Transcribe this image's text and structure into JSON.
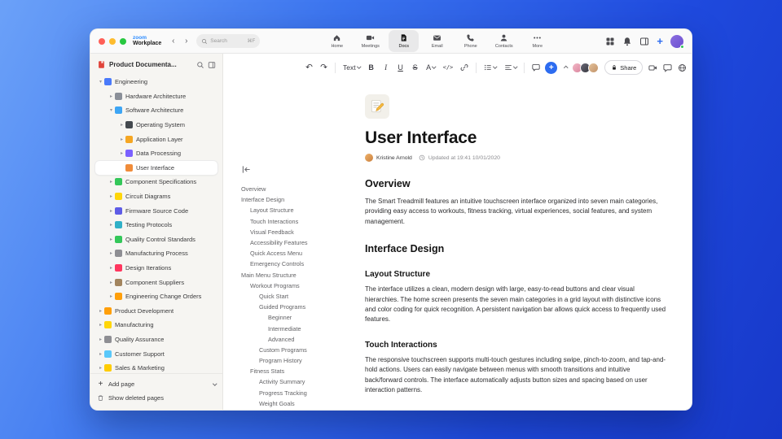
{
  "titlebar": {
    "logo": {
      "top": "zoom",
      "bottom": "Workplace"
    },
    "search": {
      "placeholder": "Search",
      "shortcut": "⌘F"
    },
    "tabs": [
      {
        "label": "Home",
        "icon": "home",
        "active": false
      },
      {
        "label": "Meetings",
        "icon": "meetings",
        "active": false
      },
      {
        "label": "Docs",
        "icon": "docs",
        "active": true
      },
      {
        "label": "Email",
        "icon": "email",
        "active": false
      },
      {
        "label": "Phone",
        "icon": "phone",
        "active": false
      },
      {
        "label": "Contacts",
        "icon": "contacts",
        "active": false
      },
      {
        "label": "More",
        "icon": "more",
        "active": false
      }
    ]
  },
  "sidebar": {
    "title": "Product Documenta...",
    "tree": [
      {
        "label": "Engineering",
        "level": 0,
        "chevron": "down",
        "color": "#4a7afa",
        "icon": "engineering"
      },
      {
        "label": "Hardware Architecture",
        "level": 1,
        "chevron": "right",
        "color": "#8a8f98",
        "icon": "hardware-architecture"
      },
      {
        "label": "Software Architecture",
        "level": 1,
        "chevron": "down",
        "color": "#3da5f4",
        "icon": "software-architecture"
      },
      {
        "label": "Operating System",
        "level": 2,
        "chevron": "right",
        "color": "#44494f",
        "icon": "operating-system"
      },
      {
        "label": "Application Layer",
        "level": 2,
        "chevron": "right",
        "color": "#f5a623",
        "icon": "application-layer"
      },
      {
        "label": "Data Processing",
        "level": 2,
        "chevron": "right",
        "color": "#7b61ff",
        "icon": "data-processing"
      },
      {
        "label": "User Interface",
        "level": 2,
        "chevron": "none",
        "color": "#f08c3a",
        "icon": "user-interface",
        "selected": true
      },
      {
        "label": "Component Specifications",
        "level": 1,
        "chevron": "right",
        "color": "#34c759",
        "icon": "component-specifications"
      },
      {
        "label": "Circuit Diagrams",
        "level": 1,
        "chevron": "right",
        "color": "#ffd60a",
        "icon": "circuit-diagrams"
      },
      {
        "label": "Firmware Source Code",
        "level": 1,
        "chevron": "right",
        "color": "#5e5ce6",
        "icon": "firmware-source-code"
      },
      {
        "label": "Testing Protocols",
        "level": 1,
        "chevron": "right",
        "color": "#30b0c7",
        "icon": "testing-protocols"
      },
      {
        "label": "Quality Control Standards",
        "level": 1,
        "chevron": "right",
        "color": "#34c759",
        "icon": "quality-control-standards"
      },
      {
        "label": "Manufacturing Process",
        "level": 1,
        "chevron": "right",
        "color": "#8e8e93",
        "icon": "manufacturing-process"
      },
      {
        "label": "Design Iterations",
        "level": 1,
        "chevron": "right",
        "color": "#ff375f",
        "icon": "design-iterations"
      },
      {
        "label": "Component Suppliers",
        "level": 1,
        "chevron": "right",
        "color": "#a2845e",
        "icon": "component-suppliers"
      },
      {
        "label": "Engineering Change Orders",
        "level": 1,
        "chevron": "right",
        "color": "#ff9f0a",
        "icon": "engineering-change-orders"
      },
      {
        "label": "Product Development",
        "level": 0,
        "chevron": "right",
        "color": "#ff9f0a",
        "icon": "product-development"
      },
      {
        "label": "Manufacturing",
        "level": 0,
        "chevron": "right",
        "color": "#ffd60a",
        "icon": "manufacturing"
      },
      {
        "label": "Quality Assurance",
        "level": 0,
        "chevron": "right",
        "color": "#8e8e93",
        "icon": "quality-assurance"
      },
      {
        "label": "Customer Support",
        "level": 0,
        "chevron": "right",
        "color": "#5ac8fa",
        "icon": "customer-support"
      },
      {
        "label": "Sales & Marketing",
        "level": 0,
        "chevron": "right",
        "color": "#ffcc00",
        "icon": "sales-marketing"
      }
    ],
    "add_page": "Add page",
    "show_deleted": "Show deleted pages"
  },
  "toolbar": {
    "buttons": [
      {
        "name": "undo",
        "glyph": "↶"
      },
      {
        "name": "redo",
        "glyph": "↷"
      },
      {
        "name": "divider"
      },
      {
        "name": "text-style",
        "glyph": "Text",
        "dropdown": true
      },
      {
        "name": "bold",
        "glyph": "B"
      },
      {
        "name": "italic",
        "glyph": "I"
      },
      {
        "name": "underline",
        "glyph": "U"
      },
      {
        "name": "strikethrough",
        "glyph": "S"
      },
      {
        "name": "text-color",
        "glyph": "A",
        "dropdown": true
      },
      {
        "name": "inline-code",
        "glyph": "</>"
      },
      {
        "name": "link",
        "icon": "link"
      },
      {
        "name": "divider"
      },
      {
        "name": "bullet-list",
        "icon": "list",
        "dropdown": true
      },
      {
        "name": "align",
        "icon": "align",
        "dropdown": true
      },
      {
        "name": "divider"
      },
      {
        "name": "comment",
        "icon": "comment"
      },
      {
        "name": "insert",
        "glyph": "+",
        "accent": true
      },
      {
        "name": "collapse-toolbar",
        "icon": "chevron-up"
      }
    ],
    "collaborators": [
      {
        "from": "#f2b8c6",
        "to": "#d9849d"
      },
      {
        "from": "#6a6a78",
        "to": "#37373f"
      },
      {
        "from": "#e3c19a",
        "to": "#c2946a"
      }
    ],
    "share": "Share"
  },
  "outline": [
    {
      "label": "Overview",
      "level": 0
    },
    {
      "label": "Interface Design",
      "level": 0
    },
    {
      "label": "Layout Structure",
      "level": 1
    },
    {
      "label": "Touch Interactions",
      "level": 1
    },
    {
      "label": "Visual Feedback",
      "level": 1
    },
    {
      "label": "Accessibility Features",
      "level": 1
    },
    {
      "label": "Quick Access Menu",
      "level": 1
    },
    {
      "label": "Emergency Controls",
      "level": 1
    },
    {
      "label": "Main Menu Structure",
      "level": 0
    },
    {
      "label": "Workout Programs",
      "level": 1
    },
    {
      "label": "Quick Start",
      "level": 2
    },
    {
      "label": "Guided Programs",
      "level": 2
    },
    {
      "label": "Beginner",
      "level": 3
    },
    {
      "label": "Intermediate",
      "level": 3
    },
    {
      "label": "Advanced",
      "level": 3
    },
    {
      "label": "Custom Programs",
      "level": 2
    },
    {
      "label": "Program History",
      "level": 2
    },
    {
      "label": "Fitness Stats",
      "level": 1
    },
    {
      "label": "Activity Summary",
      "level": 2
    },
    {
      "label": "Progress Tracking",
      "level": 2
    },
    {
      "label": "Weight Goals",
      "level": 2
    }
  ],
  "document": {
    "title": "User Interface",
    "author": "Kristine Arnold",
    "updated": "Updated at 19:41 10/01/2020",
    "blocks": [
      {
        "type": "h2",
        "text": "Overview"
      },
      {
        "type": "p",
        "text": "The Smart Treadmill features an intuitive touchscreen interface organized into seven main categories, providing easy access to workouts, fitness tracking, virtual experiences, social features, and system management."
      },
      {
        "type": "h2",
        "text": "Interface Design"
      },
      {
        "type": "h3",
        "text": "Layout Structure"
      },
      {
        "type": "p",
        "text": "The interface utilizes a clean, modern design with large, easy-to-read buttons and clear visual hierarchies. The home screen presents the seven main categories in a grid layout with distinctive icons and color coding for quick recognition. A persistent navigation bar allows quick access to frequently used features."
      },
      {
        "type": "h3",
        "text": "Touch Interactions"
      },
      {
        "type": "p",
        "text": "The responsive touchscreen supports multi-touch gestures including swipe, pinch-to-zoom, and tap-and-hold actions. Users can easily navigate between menus with smooth transitions and intuitive back/forward controls. The interface automatically adjusts button sizes and spacing based on user interaction patterns."
      }
    ]
  }
}
